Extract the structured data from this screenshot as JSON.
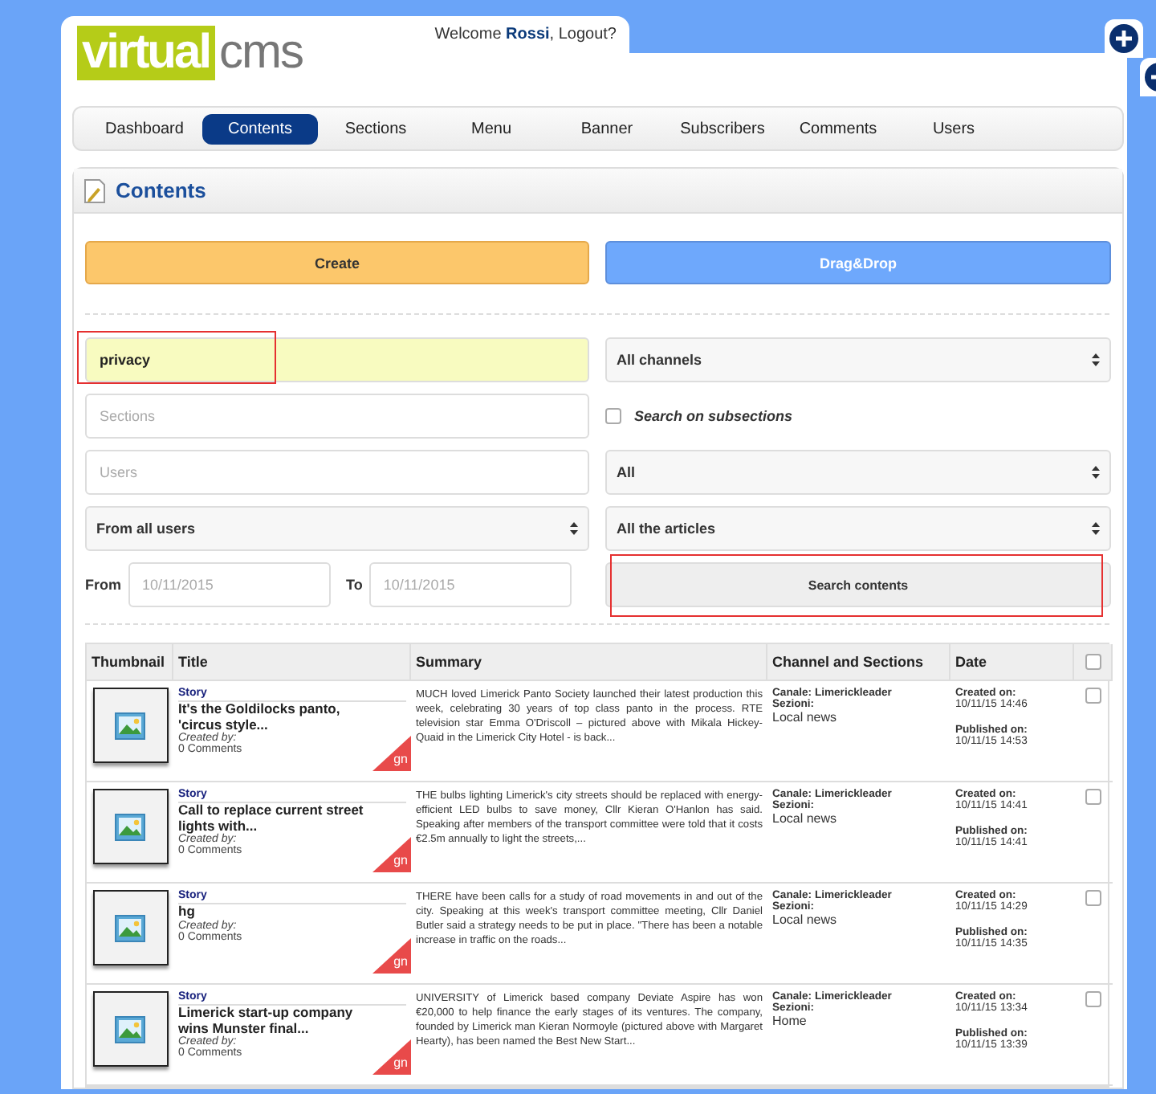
{
  "header": {
    "logo": {
      "part_1": "virtual",
      "part_2": "cms"
    },
    "welcome": "Welcome **Rossi**, Logout?"
  },
  "nav": [
    {
      "label": "Dashboard",
      "selected": false
    },
    {
      "label": "Contents",
      "selected": true
    },
    {
      "label": "Sections",
      "selected": false
    },
    {
      "label": "Menu",
      "selected": false
    },
    {
      "label": "Banner",
      "selected": false
    },
    {
      "label": "Subscribers",
      "selected": false
    },
    {
      "label": "Comments",
      "selected": false
    },
    {
      "label": "Users",
      "selected": false
    }
  ],
  "section_title": "Contents",
  "actions": [
    {
      "label": "Create",
      "kind": "create"
    },
    {
      "label": "Drag&Drop",
      "kind": "dragdrop"
    }
  ],
  "filters": {
    "search": {
      "value": "privacy",
      "highlighted": true
    },
    "channel": "All channels",
    "sections": {
      "placeholder": "Sections"
    },
    "subsections": {
      "label": "Search on subsections",
      "checked": false
    },
    "users": {
      "placeholder": "Users"
    },
    "status": "All",
    "user_scope": "From all users",
    "articles": "All the articles",
    "from": {
      "label": "From",
      "placeholder": "10/11/2015"
    },
    "to": {
      "label": "To",
      "placeholder": "10/11/2015"
    },
    "search_button": {
      "label": "Search contents",
      "highlighted": true
    }
  },
  "table": {
    "columns": [
      "Thumbnail",
      "Title",
      "Summary",
      "Channel and Sections",
      "Date"
    ],
    "header_checked": false,
    "rows": [
      {
        "type": "Story",
        "title": "It's the Goldilocks panto, 'circus style...",
        "created_by": "Created by:",
        "comments": "0 Comments",
        "badge": "gn",
        "summary": "MUCH loved Limerick Panto Society launched their latest production this week, celebrating 30 years of top class panto in the process. RTE television star Emma O'Driscoll – pictured above with Mikala Hickey-Quaid in the Limerick City Hotel - is back...",
        "channel": "Canale: Limerickleader",
        "sections_label": "Sezioni:",
        "section": "Local news",
        "created_label": "Created on:",
        "created": "10/11/15 14:46",
        "published_label": "Published on:",
        "published": "10/11/15 14:53",
        "checked": false
      },
      {
        "type": "Story",
        "title": "Call to replace current street lights with...",
        "created_by": "Created by:",
        "comments": "0 Comments",
        "badge": "gn",
        "summary": "THE bulbs lighting Limerick's city streets should be replaced with energy-efficient LED bulbs to save money, Cllr Kieran O'Hanlon has said. Speaking after members of the transport committee were told that it costs €2.5m annually to light the streets,...",
        "channel": "Canale: Limerickleader",
        "sections_label": "Sezioni:",
        "section": "Local news",
        "created_label": "Created on:",
        "created": "10/11/15 14:41",
        "published_label": "Published on:",
        "published": "10/11/15 14:41",
        "checked": false
      },
      {
        "type": "Story",
        "title": "hg",
        "created_by": "Created by:",
        "comments": "0 Comments",
        "badge": "gn",
        "summary": "THERE have been calls for a study of road movements in and out of the city. Speaking at this week's transport committee meeting, Cllr Daniel Butler said a strategy needs to be put in place. \"There has been a notable increase in traffic on the roads...",
        "channel": "Canale: Limerickleader",
        "sections_label": "Sezioni:",
        "section": "Local news",
        "created_label": "Created on:",
        "created": "10/11/15 14:29",
        "published_label": "Published on:",
        "published": "10/11/15 14:35",
        "checked": false
      },
      {
        "type": "Story",
        "title": "Limerick start-up company wins Munster final...",
        "created_by": "Created by:",
        "comments": "0 Comments",
        "badge": "gn",
        "summary": "UNIVERSITY of Limerick based company Deviate Aspire has won €20,000 to help finance the early stages of its ventures. The company, founded by Limerick man Kieran Normoyle (pictured above with Margaret Hearty), has been named the Best New Start...",
        "channel": "Canale: Limerickleader",
        "sections_label": "Sezioni:",
        "section": "Home",
        "created_label": "Created on:",
        "created": "10/11/15 13:34",
        "published_label": "Published on:",
        "published": "10/11/15 13:39",
        "checked": false
      }
    ]
  }
}
